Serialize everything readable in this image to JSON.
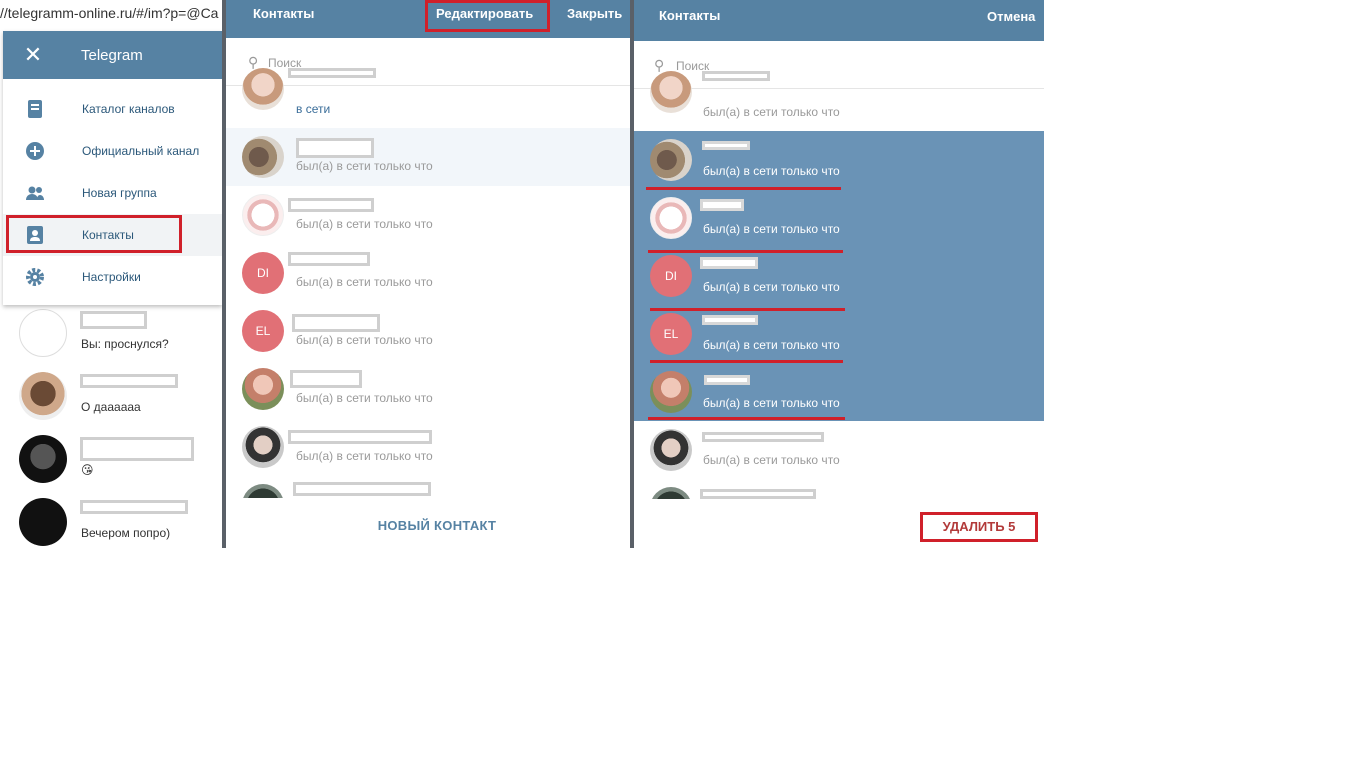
{
  "url": "//telegramm-online.ru/#/im?p=@Ca",
  "menu": {
    "title": "Telegram",
    "close": "✕",
    "items": [
      {
        "label": "Каталог каналов",
        "icon": "book-icon"
      },
      {
        "label": "Официальный канал",
        "icon": "plus-circle-icon"
      },
      {
        "label": "Новая группа",
        "icon": "group-icon"
      },
      {
        "label": "Контакты",
        "icon": "contact-card-icon"
      },
      {
        "label": "Настройки",
        "icon": "gear-icon"
      }
    ]
  },
  "chats": [
    {
      "msg": "Вы: проснулся?"
    },
    {
      "msg": "О даааааа"
    },
    {
      "msg": "😘"
    },
    {
      "msg": "Вечером попро)"
    }
  ],
  "contacts_panel": {
    "title": "Контакты",
    "edit": "Редактировать",
    "close": "Закрыть",
    "search_placeholder": "Поиск",
    "rows": [
      {
        "status": "в сети",
        "initials": ""
      },
      {
        "status": "был(а) в сети только что",
        "initials": ""
      },
      {
        "status": "был(а) в сети только что",
        "initials": ""
      },
      {
        "status": "был(а) в сети только что",
        "initials": "DI"
      },
      {
        "status": "был(а) в сети только что",
        "initials": "EL"
      },
      {
        "status": "был(а) в сети только что",
        "initials": ""
      },
      {
        "status": "был(а) в сети только что",
        "initials": ""
      }
    ],
    "new_contact": "НОВЫЙ КОНТАКТ"
  },
  "edit_panel": {
    "title": "Контакты",
    "cancel": "Отмена",
    "search_placeholder": "Поиск",
    "rows": [
      {
        "status": "был(а) в сети только что",
        "initials": ""
      },
      {
        "status": "был(а) в сети только что",
        "initials": ""
      },
      {
        "status": "был(а) в сети только что",
        "initials": ""
      },
      {
        "status": "был(а) в сети только что",
        "initials": "DI"
      },
      {
        "status": "был(а) в сети только что",
        "initials": "EL"
      },
      {
        "status": "был(а) в сети только что",
        "initials": ""
      },
      {
        "status": "был(а) в сети только что",
        "initials": ""
      }
    ],
    "delete": "УДАЛИТЬ 5"
  },
  "colors": {
    "header": "#5682a3",
    "selected": "#6a93b6",
    "highlight": "#d0202a",
    "avatar_red": "#e17076"
  }
}
